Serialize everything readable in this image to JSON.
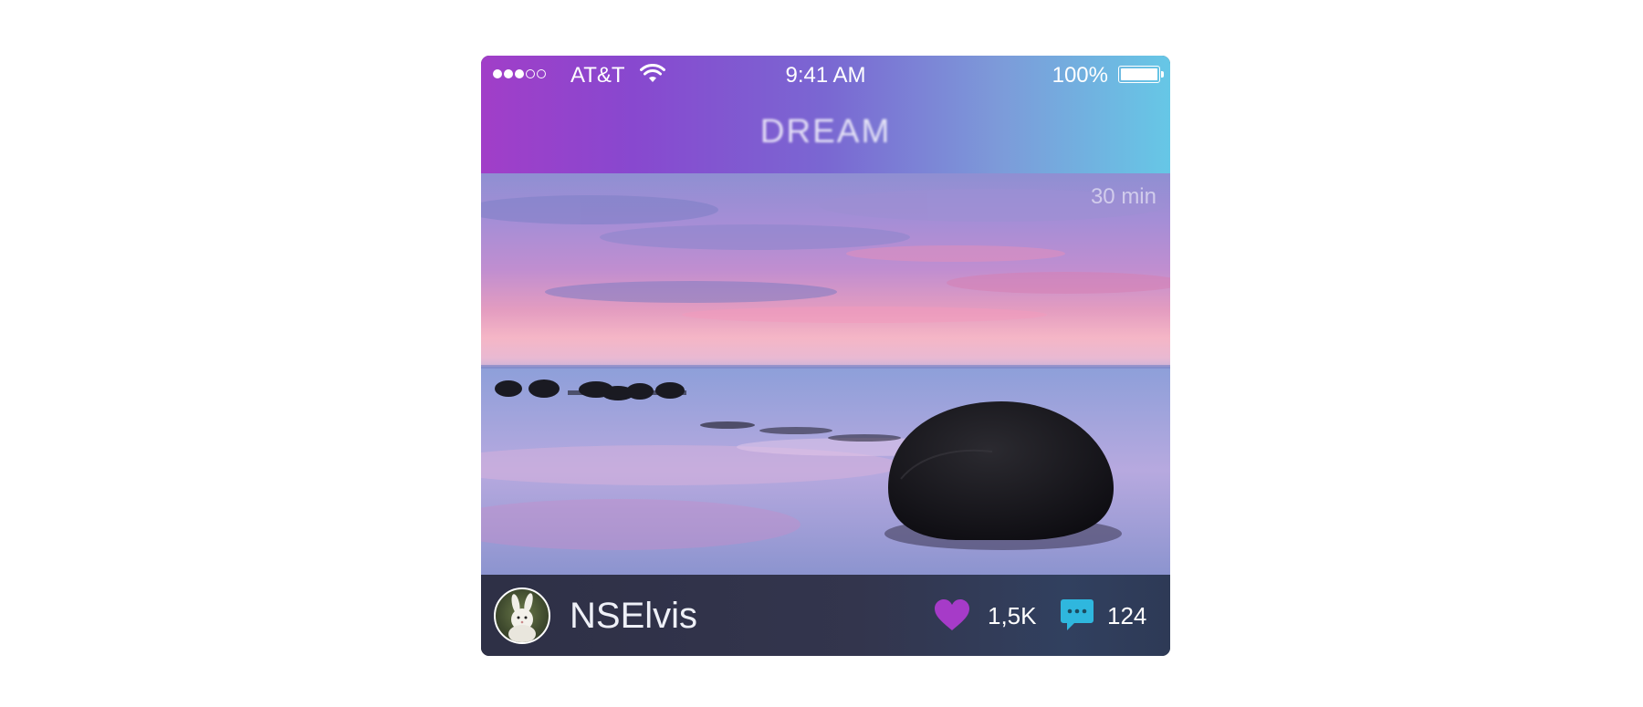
{
  "status_bar": {
    "signal_icon": "signal-dots-icon",
    "carrier": "AT&T",
    "wifi_icon": "wifi-icon",
    "time": "9:41 AM",
    "battery_percent": "100%",
    "battery_icon": "battery-icon",
    "battery_level": 1.0
  },
  "header": {
    "title": "DREAM",
    "gradient": [
      "#a13ec8",
      "#8848cf",
      "#7a67d2",
      "#7d9ad9",
      "#66c7e6"
    ]
  },
  "post": {
    "photo_alt": "",
    "elapsed": "30 min",
    "author": {
      "avatar_icon": "avatar-bunny-icon",
      "username": "NSElvis"
    },
    "likes": {
      "icon": "heart-icon",
      "count": "1,5K",
      "color": "#a63bc8"
    },
    "comments": {
      "icon": "comment-bubble-icon",
      "count": "124",
      "color": "#2fb7de"
    }
  }
}
